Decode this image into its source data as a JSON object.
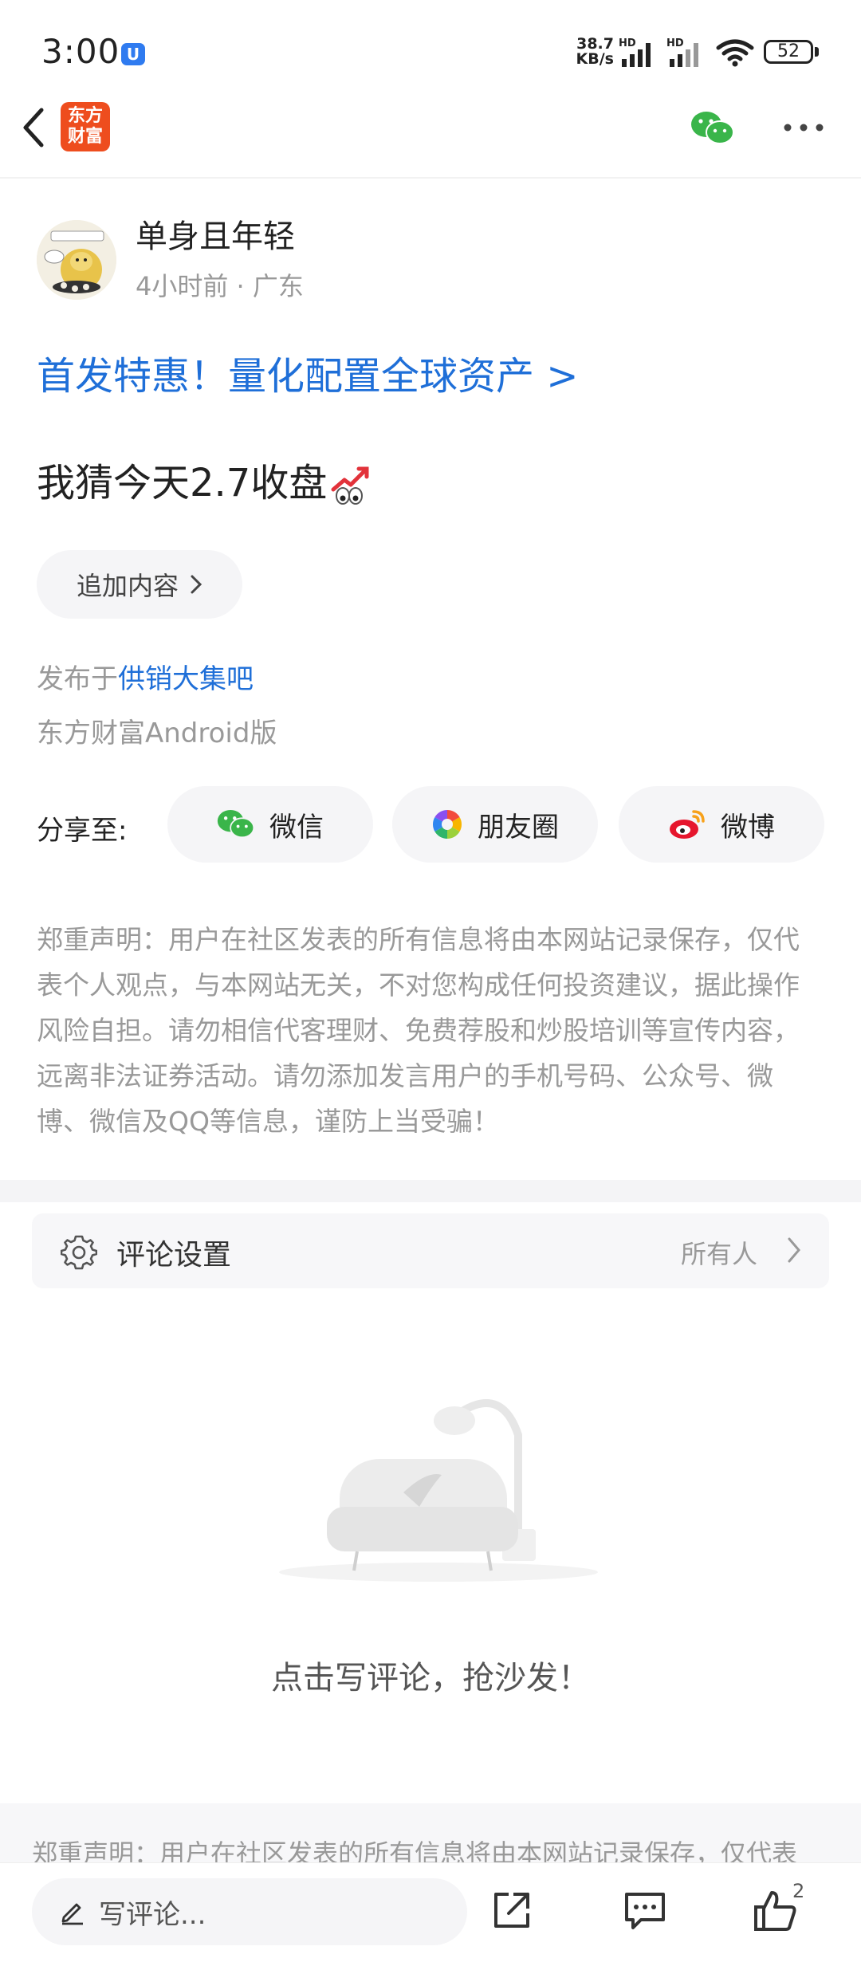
{
  "status_bar": {
    "time": "3:00",
    "app_badge": "U",
    "net_speed_value": "38.7",
    "net_speed_unit": "KB/s",
    "hd1": "HD",
    "hd2": "HD",
    "battery": "52"
  },
  "header": {
    "logo_line1": "东方",
    "logo_line2": "财富"
  },
  "post": {
    "author_name": "单身且年轻",
    "author_meta": "4小时前 · 广东",
    "promo_link": "首发特惠！量化配置全球资产 >",
    "content": "我猜今天2.7收盘",
    "add_content_label": "追加内容",
    "published_prefix": "发布于",
    "published_bar": "供销大集吧",
    "client": "东方财富Android版"
  },
  "share": {
    "label": "分享至:",
    "wechat": "微信",
    "moments": "朋友圈",
    "weibo": "微博"
  },
  "disclaimer": "郑重声明：用户在社区发表的所有信息将由本网站记录保存，仅代表个人观点，与本网站无关，不对您构成任何投资建议，据此操作风险自担。请勿相信代客理财、免费荐股和炒股培训等宣传内容，远离非法证券活动。请勿添加发言用户的手机号码、公众号、微博、微信及QQ等信息，谨防上当受骗！",
  "comment_settings": {
    "label": "评论设置",
    "value": "所有人"
  },
  "empty_state": {
    "text": "点击写评论，抢沙发！"
  },
  "bottom_disclaimer": "郑重声明：用户在社区发表的所有信息将由本网站记录保存，仅代表",
  "bottom_bar": {
    "comment_placeholder": "写评论...",
    "like_count": "2"
  },
  "colors": {
    "link_blue": "#1f6fd8",
    "brand_orange": "#ee4d1e",
    "wechat_green": "#3ab54a"
  }
}
